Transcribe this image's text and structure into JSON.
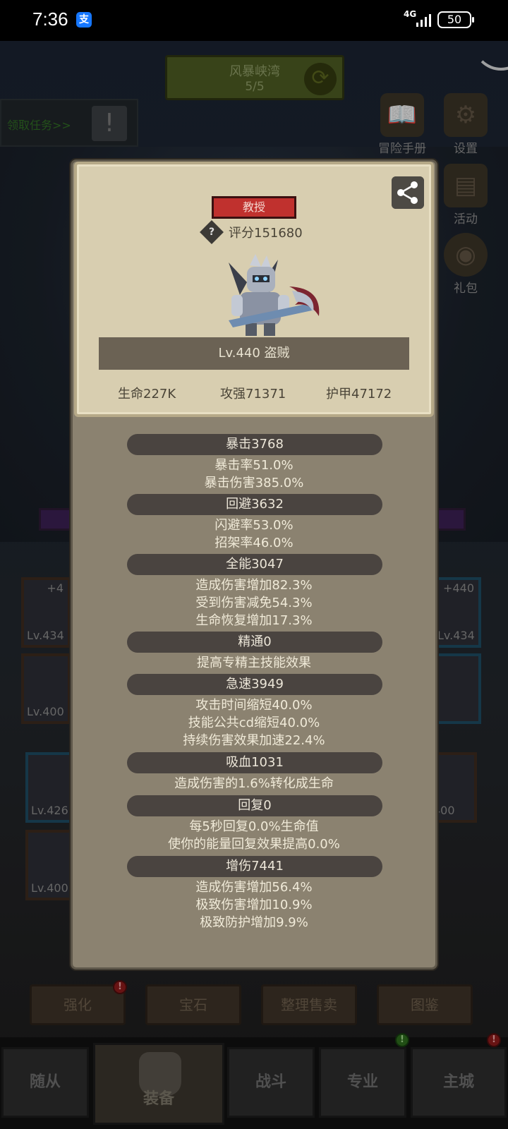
{
  "status_bar": {
    "time": "7:36",
    "alipay_badge": "支",
    "network": "4G",
    "battery": "50"
  },
  "map": {
    "name": "风暴峡湾",
    "progress": "5/5"
  },
  "quest": {
    "label": "领取任务>>"
  },
  "side_menu": [
    {
      "label": "冒险手册",
      "icon": "book-icon"
    },
    {
      "label": "设置",
      "icon": "gear-icon"
    },
    {
      "label": "活动",
      "icon": "calendar-icon"
    },
    {
      "label": "礼包",
      "icon": "gift-icon"
    }
  ],
  "equipment_slots": {
    "left_top": {
      "level": "Lv.434",
      "plus": "+4"
    },
    "left_mid": {
      "level": "Lv.400"
    },
    "right_top": {
      "level": "Lv.434",
      "plus": "+440"
    },
    "left_low1": {
      "level": "Lv.426"
    },
    "left_low2": {
      "level": "Lv.400"
    },
    "right_low": {
      "level": "400"
    }
  },
  "action_tabs": [
    {
      "label": "强化",
      "badge": "!"
    },
    {
      "label": "宝石"
    },
    {
      "label": "整理售卖"
    },
    {
      "label": "图鉴"
    }
  ],
  "bottom_nav": [
    {
      "label": "随从"
    },
    {
      "label": "装备",
      "active": true
    },
    {
      "label": "战斗"
    },
    {
      "label": "专业",
      "badge": "!"
    },
    {
      "label": "主城",
      "badge": "!"
    }
  ],
  "character": {
    "title": "教授",
    "score": "评分151680",
    "level_class": "Lv.440 盗贼",
    "hp": "生命227K",
    "attack": "攻强71371",
    "armor": "护甲47172"
  },
  "attributes": [
    {
      "name": "暴击3768",
      "lines": [
        "暴击率51.0%",
        "暴击伤害385.0%"
      ]
    },
    {
      "name": "回避3632",
      "lines": [
        "闪避率53.0%",
        "招架率46.0%"
      ]
    },
    {
      "name": "全能3047",
      "lines": [
        "造成伤害增加82.3%",
        "受到伤害减免54.3%",
        "生命恢复增加17.3%"
      ]
    },
    {
      "name": "精通0",
      "lines": [
        "提高专精主技能效果"
      ]
    },
    {
      "name": "急速3949",
      "lines": [
        "攻击时间缩短40.0%",
        "技能公共cd缩短40.0%",
        "持续伤害效果加速22.4%"
      ]
    },
    {
      "name": "吸血1031",
      "lines": [
        "造成伤害的1.6%转化成生命"
      ]
    },
    {
      "name": "回复0",
      "lines": [
        "每5秒回复0.0%生命值",
        "使你的能量回复效果提高0.0%"
      ]
    },
    {
      "name": "增伤7441",
      "lines": [
        "造成伤害增加56.4%",
        "极致伤害增加10.9%",
        "极致防护增加9.9%"
      ]
    }
  ],
  "colors": {
    "title_tag": "#c0312e",
    "card_bg": "#d8ceb0",
    "panel_bg": "#8b8270"
  }
}
